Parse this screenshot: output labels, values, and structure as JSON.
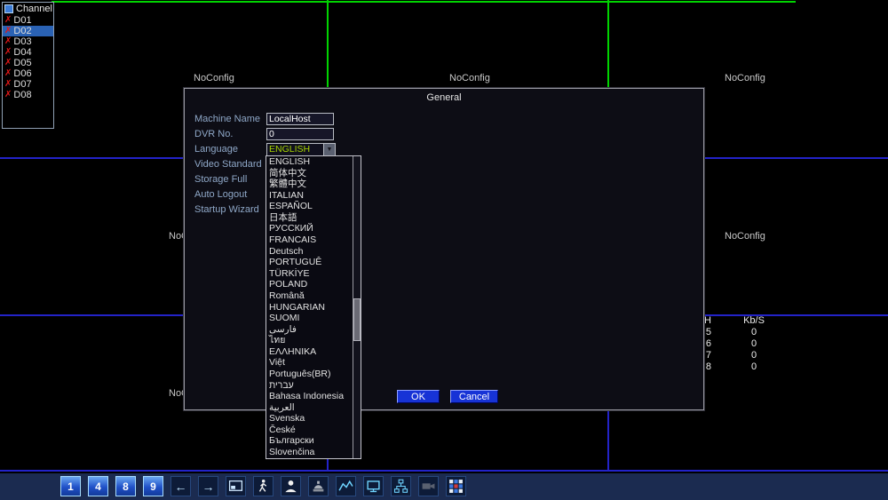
{
  "channel_panel": {
    "title": "Channel",
    "offline_glyph": "✗",
    "items": [
      {
        "label": "D01",
        "selected": false
      },
      {
        "label": "D02",
        "selected": true
      },
      {
        "label": "D03",
        "selected": false
      },
      {
        "label": "D04",
        "selected": false
      },
      {
        "label": "D05",
        "selected": false
      },
      {
        "label": "D06",
        "selected": false
      },
      {
        "label": "D07",
        "selected": false
      },
      {
        "label": "D08",
        "selected": false
      }
    ]
  },
  "video_grid": {
    "noconfig_labels": [
      "NoConfig",
      "NoConfig",
      "NoConfig",
      "NoConfig",
      "NoConfig",
      "NoConfig"
    ]
  },
  "dialog": {
    "title": "General",
    "fields": {
      "machine_name": {
        "label": "Machine Name",
        "value": "LocalHost"
      },
      "dvr_no": {
        "label": "DVR No.",
        "value": "0"
      },
      "language": {
        "label": "Language",
        "value": "ENGLISH"
      },
      "video_standard": {
        "label": "Video Standard"
      },
      "storage_full": {
        "label": "Storage Full"
      },
      "auto_logout": {
        "label": "Auto Logout"
      },
      "startup_wizard": {
        "label": "Startup Wizard"
      }
    },
    "buttons": {
      "ok": "OK",
      "cancel": "Cancel"
    }
  },
  "language_dropdown": {
    "selected": "ENGLISH",
    "options": [
      "ENGLISH",
      "简体中文",
      "繁體中文",
      "ITALIAN",
      "ESPAÑOL",
      "日本語",
      "РУССКИЙ",
      "FRANCAIS",
      "Deutsch",
      "PORTUGUÊ",
      "TÜRKİYE",
      "POLAND",
      "Română",
      "HUNGARIAN",
      "SUOMI",
      "فارسی",
      "ไทย",
      "ΕΛΛΗΝΙΚΑ",
      "Việt",
      "Português(BR)",
      "עברית",
      "Bahasa Indonesia",
      "العربية",
      "Svenska",
      "České",
      "Български",
      "Slovenčina"
    ]
  },
  "bitrate_table": {
    "col1_header": "H",
    "col2_header": "Kb/S",
    "rows": [
      {
        "ch": "5",
        "kbs": "0"
      },
      {
        "ch": "6",
        "kbs": "0"
      },
      {
        "ch": "7",
        "kbs": "0"
      },
      {
        "ch": "8",
        "kbs": "0"
      }
    ]
  },
  "toolbar": {
    "buttons": [
      {
        "name": "view-1",
        "icon": "num",
        "label": "1"
      },
      {
        "name": "view-4",
        "icon": "num",
        "label": "4"
      },
      {
        "name": "view-8",
        "icon": "num",
        "label": "8"
      },
      {
        "name": "view-9",
        "icon": "num",
        "label": "9"
      },
      {
        "name": "prev-page",
        "icon": "arrow-left",
        "label": ""
      },
      {
        "name": "next-page",
        "icon": "arrow-right",
        "label": ""
      },
      {
        "name": "single-screen",
        "icon": "monitor-box",
        "label": ""
      },
      {
        "name": "tour",
        "icon": "person-walking",
        "label": ""
      },
      {
        "name": "user",
        "icon": "person-bust",
        "label": ""
      },
      {
        "name": "ptz",
        "icon": "ptz-dome",
        "label": ""
      },
      {
        "name": "bitrate",
        "icon": "line-chart",
        "label": ""
      },
      {
        "name": "display",
        "icon": "monitor",
        "label": ""
      },
      {
        "name": "network",
        "icon": "network-tree",
        "label": ""
      },
      {
        "name": "record",
        "icon": "camera",
        "label": ""
      },
      {
        "name": "channel-status",
        "icon": "color-grid",
        "label": ""
      }
    ]
  },
  "colors": {
    "grid_line_blue": "#2323c8",
    "selection_green": "#00d400",
    "language_value_green": "#a6d400",
    "button_blue": "#1733d6"
  }
}
